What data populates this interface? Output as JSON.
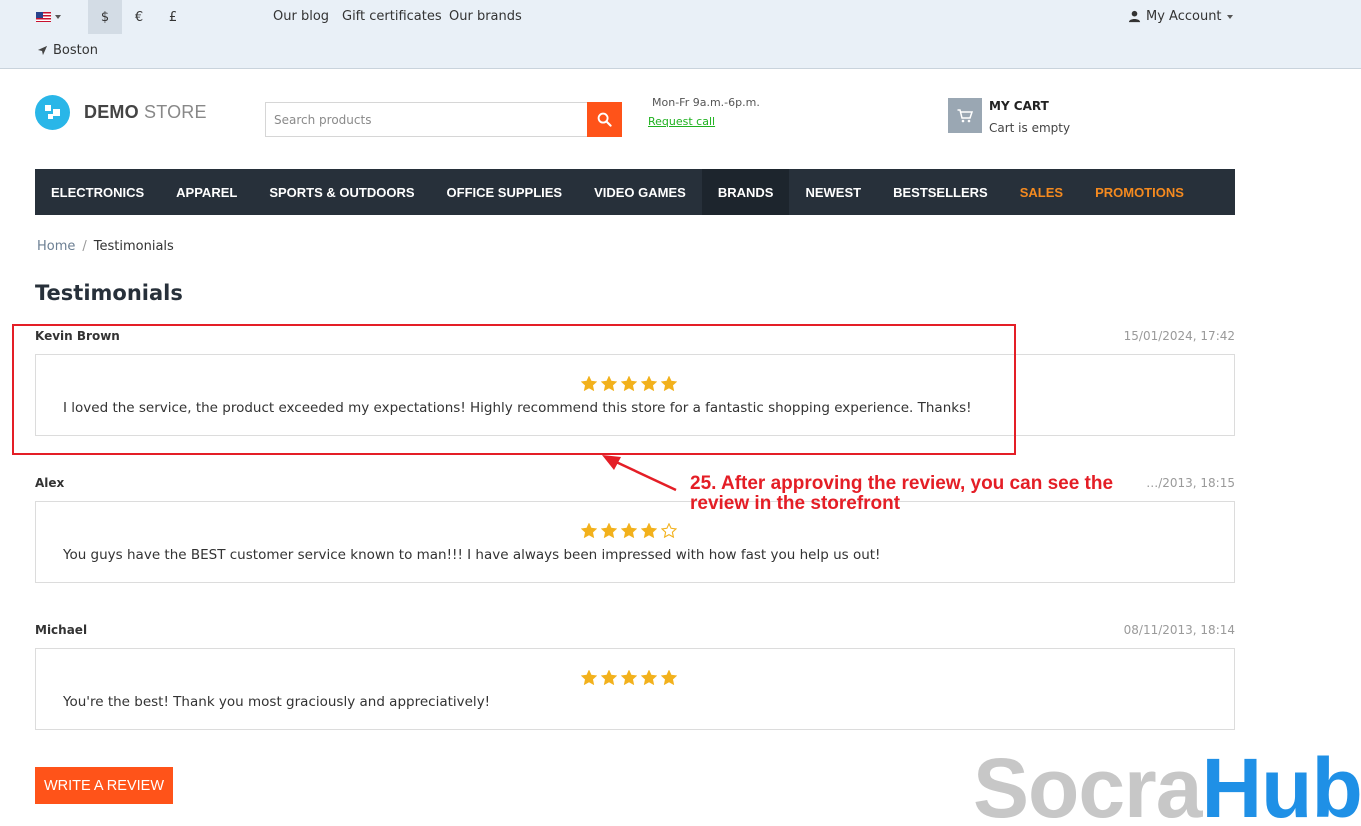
{
  "topbar": {
    "currencies": [
      "$",
      "€",
      "£"
    ],
    "active_currency": "$",
    "links": [
      "Our blog",
      "Gift certificates",
      "Our brands"
    ],
    "location": "Boston",
    "account_label": "My Account"
  },
  "header": {
    "logo_bold": "DEMO",
    "logo_light": "STORE",
    "search_placeholder": "Search products",
    "hours": "Mon-Fr 9a.m.-6p.m.",
    "request_call": "Request call",
    "cart_title": "MY CART",
    "cart_status": "Cart is empty"
  },
  "nav": {
    "items": [
      {
        "label": "ELECTRONICS"
      },
      {
        "label": "APPAREL"
      },
      {
        "label": "SPORTS & OUTDOORS"
      },
      {
        "label": "OFFICE SUPPLIES"
      },
      {
        "label": "VIDEO GAMES"
      },
      {
        "label": "BRANDS",
        "active": true
      },
      {
        "label": "NEWEST"
      },
      {
        "label": "BESTSELLERS"
      },
      {
        "label": "SALES",
        "accent": true
      },
      {
        "label": "PROMOTIONS",
        "accent": true
      }
    ],
    "accent_color": "#f58a1f"
  },
  "breadcrumb": {
    "home": "Home",
    "separator": "/",
    "current": "Testimonials"
  },
  "page": {
    "title": "Testimonials"
  },
  "reviews": [
    {
      "author": "Kevin Brown",
      "date": "15/01/2024, 17:42",
      "rating": 5,
      "message": "I loved the service, the product exceeded my expectations! Highly recommend this store for a fantastic shopping experience. Thanks!"
    },
    {
      "author": "Alex",
      "date": "…/2013, 18:15",
      "rating": 4,
      "message": "You guys have the BEST customer service known to man!!! I have always been impressed with how fast you help us out!"
    },
    {
      "author": "Michael",
      "date": "08/11/2013, 18:14",
      "rating": 5,
      "message": "You're the best! Thank you most graciously and appreciatively!"
    }
  ],
  "write_review_label": "WRITE A REVIEW",
  "annotation": {
    "line1": "25. After approving the review, you can see the",
    "line2": "review in the storefront",
    "color": "#e41e26"
  },
  "watermark": {
    "part1": "Socra",
    "part2": "Hub"
  },
  "colors": {
    "brand_orange": "#ff5319",
    "nav_bg": "#27303a",
    "star": "#f2b11c",
    "logo_blue": "#29b6e8"
  }
}
